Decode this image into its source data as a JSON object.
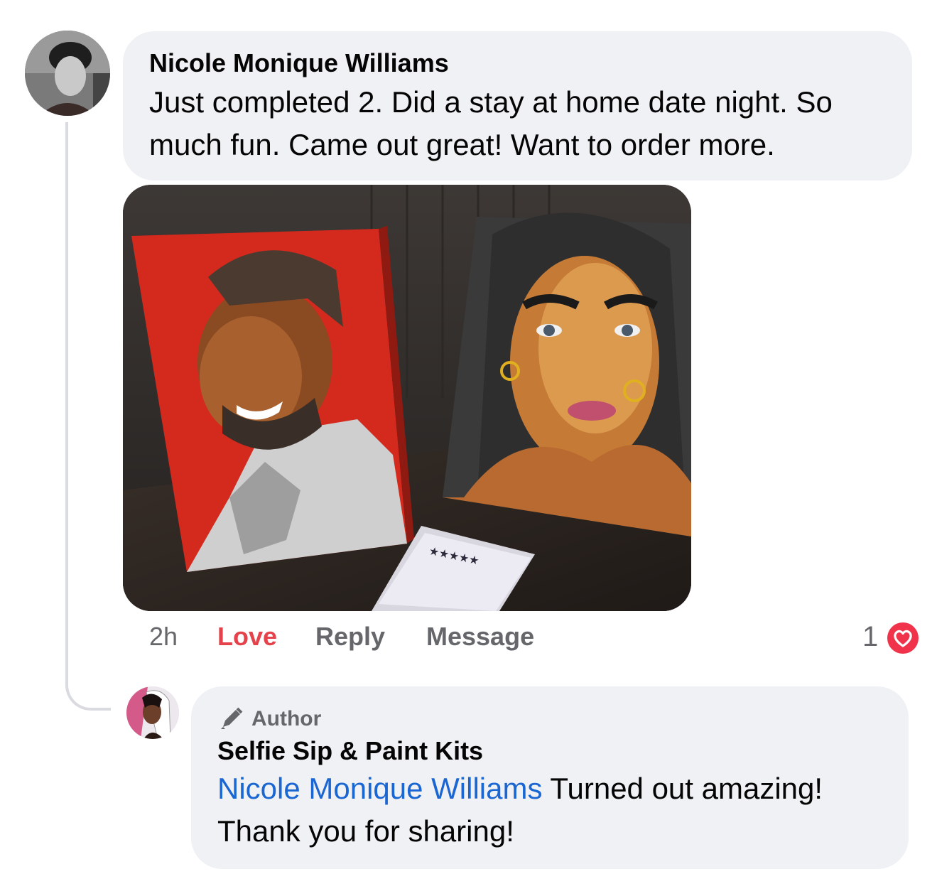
{
  "comment": {
    "author": "Nicole Monique Williams",
    "text": "Just completed 2. Did a stay at home date night. So much fun. Came out great! Want to order more.",
    "time": "2h",
    "actions": {
      "love": "Love",
      "reply": "Reply",
      "message": "Message"
    },
    "reaction_count": "1",
    "reaction_icon": "heart-icon",
    "colors": {
      "love_active": "#e4434b",
      "bubble": "#eff1f4",
      "meta": "#65676b"
    }
  },
  "reply": {
    "badge_icon": "pencil-icon",
    "badge": "Author",
    "author": "Selfie Sip & Paint Kits",
    "mention": "Nicole Monique Williams",
    "text": "Turned out amazing! Thank you for sharing!",
    "colors": {
      "mention": "#1a66d2"
    }
  }
}
